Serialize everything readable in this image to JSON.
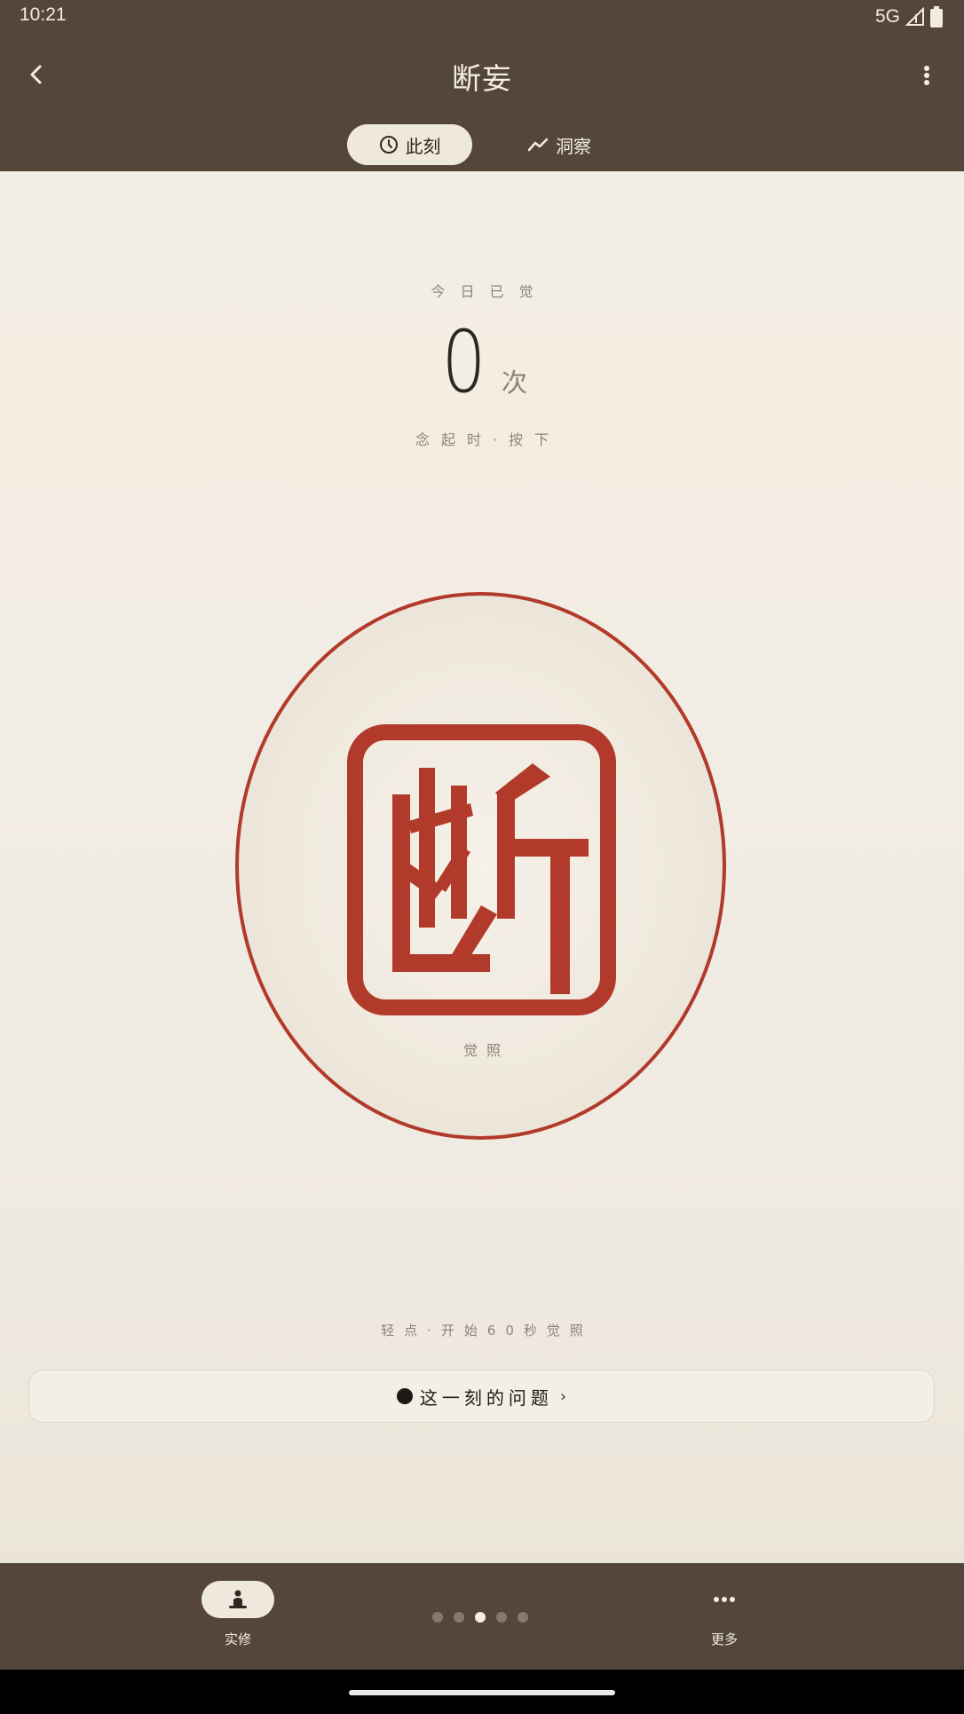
{
  "status_bar": {
    "time": "10:21",
    "network": "5G"
  },
  "header": {
    "title": "断妄",
    "tabs": [
      {
        "label": "此刻",
        "icon": "clock-icon",
        "active": true
      },
      {
        "label": "洞察",
        "icon": "trend-icon",
        "active": false
      }
    ]
  },
  "main": {
    "stat_label": "今日已觉",
    "count": "0",
    "count_unit": "次",
    "hint_top": "念起时·按下",
    "seal_caption": "觉照",
    "hint_bottom": "轻点·开始60秒觉照",
    "question_label": "这一刻的问题",
    "question_arrow": "›"
  },
  "bottom_nav": {
    "practice_label": "实修",
    "more_label": "更多",
    "page_count": 5,
    "active_page": 3
  },
  "colors": {
    "header_bg": "#54473a",
    "accent_red": "#b23a2b",
    "page_bg": "#f1ece3"
  }
}
